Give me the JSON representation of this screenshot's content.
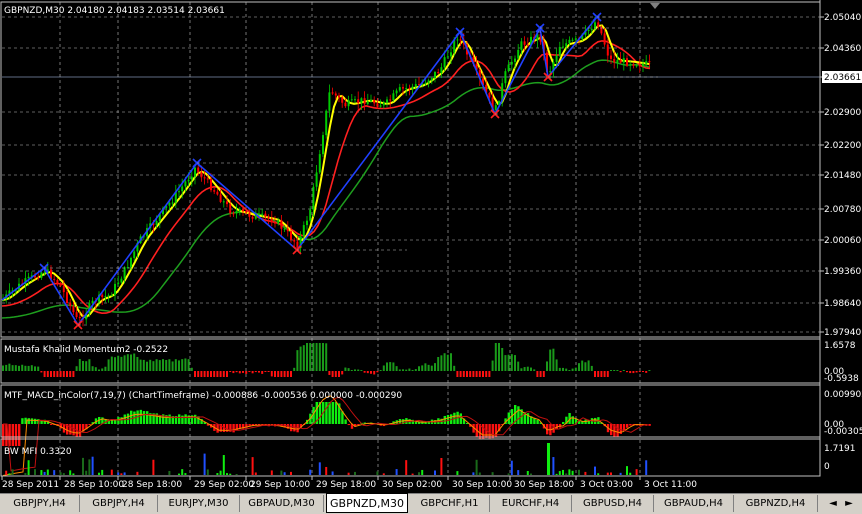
{
  "main_chart": {
    "title": "GBPNZD,M30  2.04180 2.04183 2.03514 2.03661",
    "price_levels": [
      "2.05040",
      "2.04360",
      "2.03661",
      "2.02900",
      "2.02200",
      "2.01480",
      "2.00780",
      "2.00060",
      "1.99360",
      "1.98640",
      "1.97940"
    ],
    "current_price": "2.03661",
    "colors": {
      "bull": "#00cc00",
      "bear": "#ff0000",
      "ma_fast": "#ffff00",
      "ma_mid": "#ff2020",
      "ma_slow": "#1e9e1e",
      "zigzag": "#2040ff",
      "grid": "#c0c0c0"
    }
  },
  "momentum_panel": {
    "label": "Mustafa Khalid Momentum2 -0.2522",
    "levels": [
      "1.6578",
      "0.00",
      "-0.5938"
    ]
  },
  "macd_panel": {
    "label": "MTF_MACD_inColor(7,19,7) (ChartTimeframe) -0.000886 -0.000536 0.000000 -0.000290",
    "levels": [
      "0.009902",
      "0.00",
      "-0.00305"
    ]
  },
  "mfi_panel": {
    "label": "BW MFI 0.3320",
    "levels": [
      "1.7191",
      "0"
    ]
  },
  "time_axis": [
    "28 Sep 2011",
    "28 Sep 10:00",
    "28 Sep 18:00",
    "29 Sep 02:00",
    "29 Sep 10:00",
    "29 Sep 18:00",
    "30 Sep 02:00",
    "30 Sep 10:00",
    "30 Sep 18:00",
    "3 Oct 03:00",
    "3 Oct 11:00"
  ],
  "tabs": [
    {
      "label": "GBPJPY,H4"
    },
    {
      "label": "GBPJPY,H4"
    },
    {
      "label": "EURJPY,M30"
    },
    {
      "label": "GBPAUD,M30"
    },
    {
      "label": "GBPNZD,M30"
    },
    {
      "label": "GBPCHF,H1"
    },
    {
      "label": "EURCHF,H4"
    },
    {
      "label": "GBPUSD,H4"
    },
    {
      "label": "GBPAUD,H4"
    },
    {
      "label": "GBPNZD,H4"
    }
  ],
  "active_tab": 4,
  "scroll_left_icon": "◄",
  "scroll_right_icon": "►"
}
